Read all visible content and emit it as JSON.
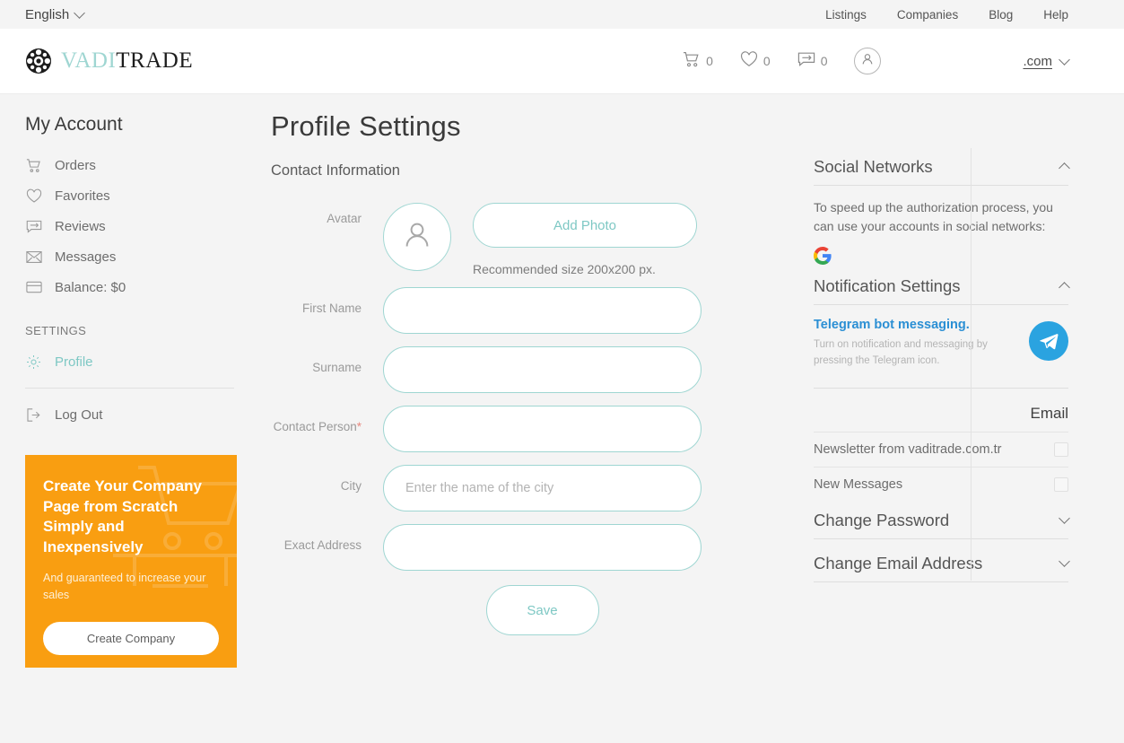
{
  "topbar": {
    "language": "English",
    "nav": [
      {
        "label": "Listings"
      },
      {
        "label": "Companies"
      },
      {
        "label": "Blog"
      },
      {
        "label": "Help"
      }
    ]
  },
  "header": {
    "brand_first": "VADI",
    "brand_second": "TRADE",
    "cart_count": "0",
    "favorites_count": "0",
    "messages_count": "0",
    "domain": ".com"
  },
  "sidebar": {
    "title": "My Account",
    "items": [
      {
        "label": "Orders",
        "icon": "cart-icon"
      },
      {
        "label": "Favorites",
        "icon": "heart-icon"
      },
      {
        "label": "Reviews",
        "icon": "review-icon"
      },
      {
        "label": "Messages",
        "icon": "envelope-icon"
      },
      {
        "label": "Balance: $0",
        "icon": "card-icon"
      }
    ],
    "group_title": "SETTINGS",
    "profile": "Profile",
    "logout": "Log Out"
  },
  "promo": {
    "heading": "Create Your Company Page from Scratch Simply and Inexpensively",
    "subtext": "And guaranteed to increase your sales",
    "button": "Create Company",
    "bg_color": "#f99e11"
  },
  "main": {
    "title": "Profile Settings",
    "section": "Contact Information",
    "avatar_label": "Avatar",
    "add_photo": "Add Photo",
    "recommendation": "Recommended size 200x200 px.",
    "fields": [
      {
        "label": "First Name",
        "value": "",
        "placeholder": "",
        "required": false
      },
      {
        "label": "Surname",
        "value": "",
        "placeholder": "",
        "required": false
      },
      {
        "label": "Contact Person",
        "value": "",
        "placeholder": "",
        "required": true
      },
      {
        "label": "City",
        "value": "",
        "placeholder": "Enter the name of the city",
        "required": false
      },
      {
        "label": "Exact Address",
        "value": "",
        "placeholder": "",
        "required": false
      }
    ],
    "required_marker": "*",
    "save": "Save"
  },
  "right": {
    "social": {
      "title": "Social Networks",
      "text": "To speed up the authorization process, you can use your accounts in social networks:",
      "provider": "google-icon"
    },
    "notifications": {
      "title": "Notification Settings",
      "telegram_title": "Telegram bot messaging.",
      "telegram_desc": "Turn on notification and messaging by pressing the Telegram icon.",
      "email_label": "Email",
      "checkboxes": [
        {
          "label": "Newsletter from vaditrade.com.tr",
          "checked": false
        },
        {
          "label": "New Messages",
          "checked": false
        }
      ]
    },
    "change_password": "Change Password",
    "change_email": "Change Email Address"
  },
  "colors": {
    "accent_teal": "#7ec8c4",
    "promo_orange": "#f99e11",
    "telegram_blue": "#2aa3e0",
    "required_red": "#e8897f"
  }
}
